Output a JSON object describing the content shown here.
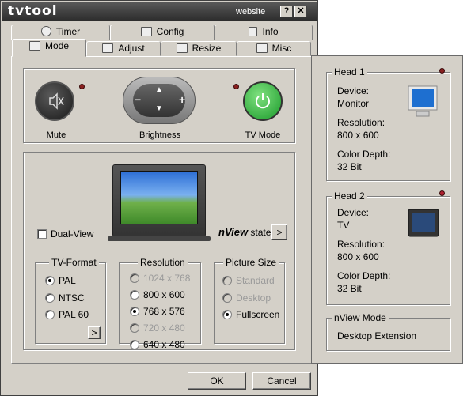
{
  "window": {
    "title": "tvtool",
    "website": "website",
    "help_glyph": "?",
    "close_glyph": "✕"
  },
  "tabs_back": [
    {
      "label": "Timer",
      "icon": "clock-icon"
    },
    {
      "label": "Config",
      "icon": "wrench-icon"
    },
    {
      "label": "Info",
      "icon": "info-icon"
    }
  ],
  "tabs_front": [
    {
      "label": "Mode",
      "icon": "monitor-icon",
      "active": true
    },
    {
      "label": "Adjust",
      "icon": "arrows-icon"
    },
    {
      "label": "Resize",
      "icon": "resize-icon"
    },
    {
      "label": "Misc",
      "icon": "speaker-icon"
    }
  ],
  "controls": {
    "mute": "Mute",
    "brightness": "Brightness",
    "tvmode": "TV Mode"
  },
  "dualview": {
    "label": "Dual-View",
    "checked": false
  },
  "nview": {
    "bold": "nView",
    "rest": " state",
    "more": ">"
  },
  "tv_format": {
    "title": "TV-Format",
    "options": [
      "PAL",
      "NTSC",
      "PAL 60"
    ],
    "selected": "PAL",
    "more": ">"
  },
  "resolution": {
    "title": "Resolution",
    "options": [
      "1024 x 768",
      "800 x 600",
      "768 x 576",
      "720 x 480",
      "640 x 480"
    ],
    "selected": "768 x 576",
    "disabled": [
      "1024 x 768",
      "720 x 480"
    ]
  },
  "picture_size": {
    "title": "Picture Size",
    "options": [
      "Standard",
      "Desktop",
      "Fullscreen"
    ],
    "selected": "Fullscreen",
    "disabled": [
      "Standard",
      "Desktop"
    ]
  },
  "buttons": {
    "ok": "OK",
    "cancel": "Cancel"
  },
  "head1": {
    "title": "Head 1",
    "device_label": "Device:",
    "device": "Monitor",
    "res_label": "Resolution:",
    "res": "800 x 600",
    "depth_label": "Color Depth:",
    "depth": "32 Bit"
  },
  "head2": {
    "title": "Head 2",
    "device_label": "Device:",
    "device": "TV",
    "res_label": "Resolution:",
    "res": "800 x 600",
    "depth_label": "Color Depth:",
    "depth": "32 Bit"
  },
  "nview_mode": {
    "title": "nView Mode",
    "value": "Desktop Extension"
  }
}
